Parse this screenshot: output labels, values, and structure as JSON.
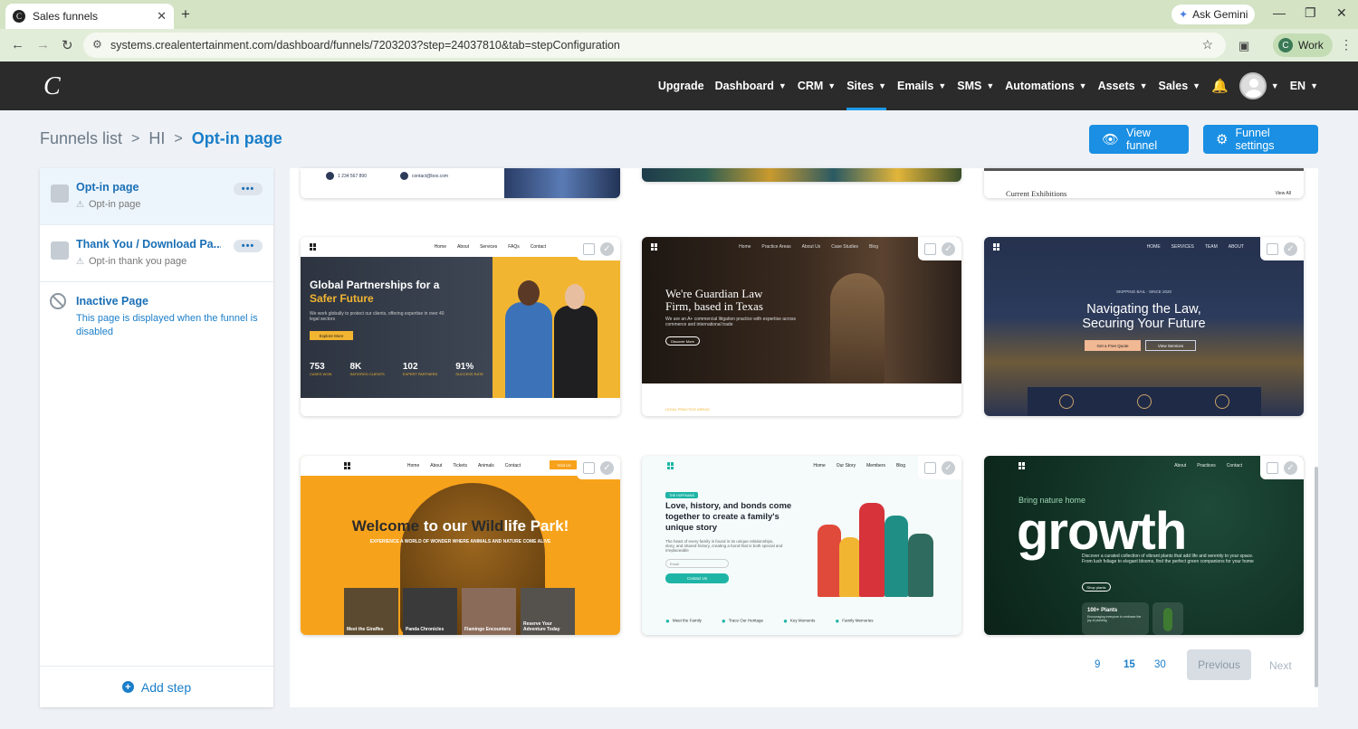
{
  "browser": {
    "tab_title": "Sales funnels",
    "favicon_letter": "C",
    "new_tab": "+",
    "tab_close": "✕",
    "ask_gemini": "Ask Gemini",
    "url": "systems.crealentertainment.com/dashboard/funnels/7203203?step=24037810&tab=stepConfiguration",
    "profile_initial": "C",
    "profile_label": "Work"
  },
  "app": {
    "logo": "C",
    "nav": [
      {
        "label": "Upgrade",
        "caret": false
      },
      {
        "label": "Dashboard",
        "caret": true
      },
      {
        "label": "CRM",
        "caret": true
      },
      {
        "label": "Sites",
        "caret": true,
        "active": true
      },
      {
        "label": "Emails",
        "caret": true
      },
      {
        "label": "SMS",
        "caret": true
      },
      {
        "label": "Automations",
        "caret": true
      },
      {
        "label": "Assets",
        "caret": true
      },
      {
        "label": "Sales",
        "caret": true
      }
    ],
    "language": "EN"
  },
  "breadcrumb": {
    "items": [
      "Funnels list",
      "HI",
      "Opt-in page"
    ],
    "separator": ">"
  },
  "actions": {
    "view_funnel": "View funnel",
    "funnel_settings": "Funnel settings"
  },
  "sidebar": {
    "steps": [
      {
        "title": "Opt-in page",
        "subtitle": "Opt-in page",
        "more": "•••",
        "active": true
      },
      {
        "title": "Thank You / Download Pa...",
        "subtitle": "Opt-in thank you page",
        "more": "•••",
        "active": false
      }
    ],
    "inactive": {
      "title": "Inactive Page",
      "description": "This page is displayed when the funnel is disabled"
    },
    "add_step": "Add step"
  },
  "templates": {
    "top_row": {
      "t1_phone": "1 234 567 890",
      "t1_mail": "contact@box.com",
      "t3_title": "Current Exhibitions",
      "t3_link": "View All"
    },
    "card1": {
      "nav": [
        "Home",
        "About",
        "Services",
        "FAQs",
        "Contact"
      ],
      "title_line1": "Global Partnerships for a",
      "title_line2": "Safer Future",
      "text": "We work globally to protect our clients, offering expertise in over 40 legal sectors",
      "cta": "Explore More",
      "stats": [
        {
          "n": "753",
          "l": "CASES WON"
        },
        {
          "n": "8K",
          "l": "SATISFIED CLIENTS"
        },
        {
          "n": "102",
          "l": "EXPERT PARTNERS"
        },
        {
          "n": "91%",
          "l": "SUCCESS RATE"
        }
      ]
    },
    "card2": {
      "nav": [
        "Home",
        "Practice Areas",
        "About Us",
        "Case Studies",
        "Blog"
      ],
      "title_line1": "We're Guardian Law",
      "title_line2": "Firm, based in Texas",
      "text": "We are an A+ commercial litigation practice with expertise across commerce and international trade",
      "cta": "Discover More",
      "footer": "LEGAL PRACTICE AREAS"
    },
    "card3": {
      "nav": [
        "HOME",
        "SERVICES",
        "TEAM",
        "ABOUT"
      ],
      "tag": "SKIPPING BAIL · SINCE 2020",
      "title_line1": "Navigating the Law,",
      "title_line2": "Securing Your Future",
      "btn1": "Get a Free Quote",
      "btn2": "View Services"
    },
    "card4": {
      "nav": [
        "Home",
        "About",
        "Tickets",
        "Animals",
        "Contact"
      ],
      "cta": "Visit Us",
      "title_a": "Welcome",
      "title_b": "to our",
      "title_c": "Wild",
      "title_d": "life Park!",
      "text": "EXPERIENCE A WORLD OF WONDER WHERE ANIMALS AND NATURE COME ALIVE",
      "thumbs": [
        "Meet the Giraffes",
        "Panda Chronicles",
        "Flamingo Encounters",
        "Reserve Your Adventure Today"
      ]
    },
    "card5": {
      "nav": [
        "Home",
        "Our Story",
        "Members",
        "Blog"
      ],
      "tag": "THE HOFFMANS",
      "title": "Love, history, and bonds come together to create a family's unique story",
      "text": "The heart of every family is found in its unique relationships, story, and shared history, creating a bond that is both special and irreplaceable",
      "email": "Email",
      "cta": "Contact Us",
      "features": [
        "Meet the Family",
        "Trace Our Heritage",
        "Key Moments",
        "Family Memories"
      ]
    },
    "card6": {
      "nav": [
        "About",
        "Practices",
        "Contact"
      ],
      "tag": "Bring nature home",
      "title": "growth",
      "text": "Discover a curated collection of vibrant plants that add life and serenity to your space. From lush foliage to elegant blooms, find the perfect green companions for your home",
      "cta": "Shop plants",
      "box_title": "100+ Plants",
      "box_text": "Encouraging everyone to embrace the joy of planting"
    }
  },
  "pagination": {
    "sizes": [
      "9",
      "15",
      "30"
    ],
    "selected": "15",
    "previous": "Previous",
    "next": "Next"
  },
  "colors": {
    "primary": "#1a8fe3",
    "header": "#2b2b2b",
    "accent_underline": "#1e9be8"
  }
}
